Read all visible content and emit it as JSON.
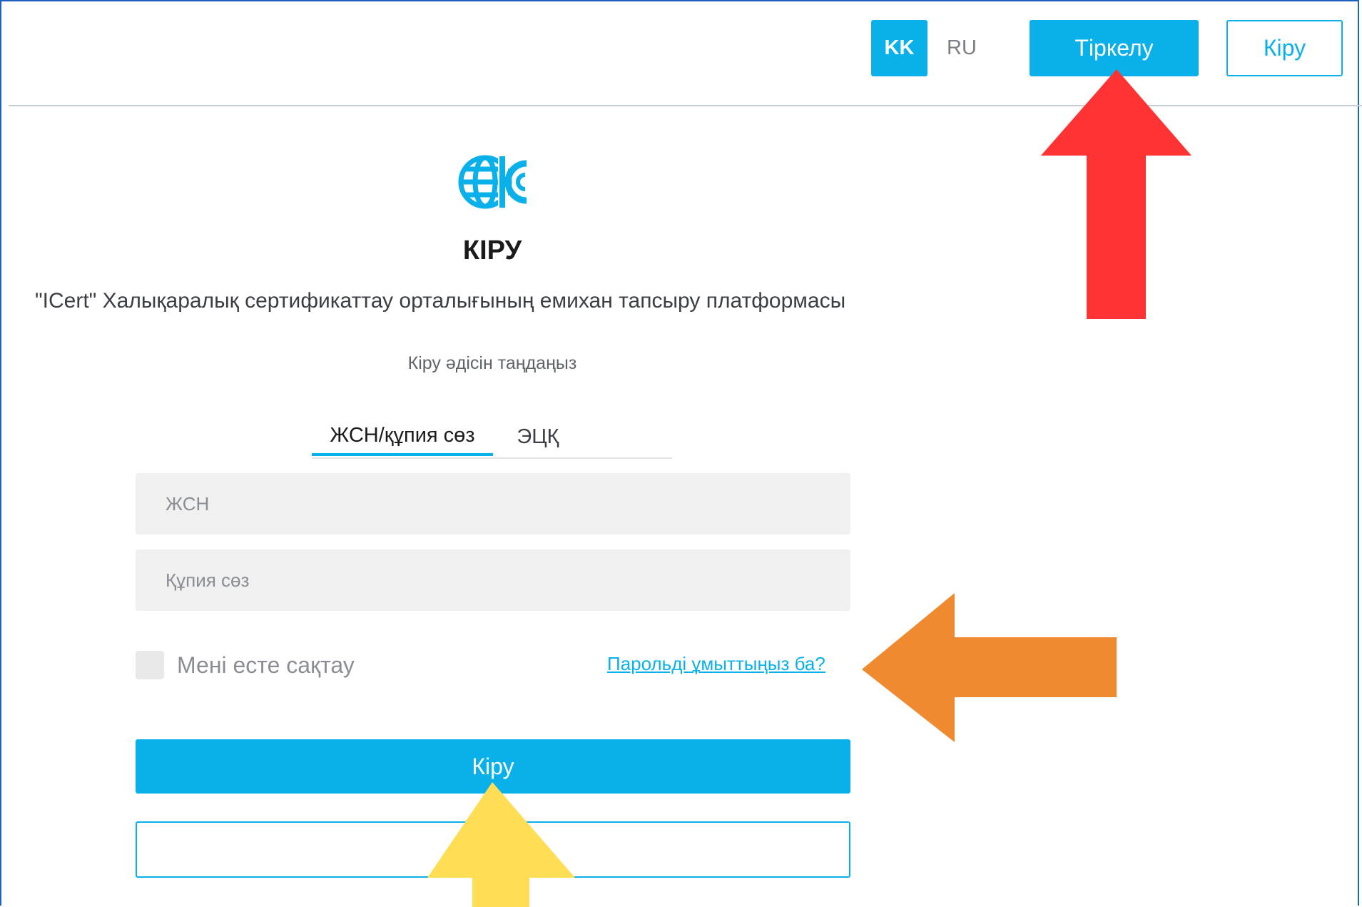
{
  "header": {
    "lang_kk": "KK",
    "lang_ru": "RU",
    "register_label": "Тіркелу",
    "login_label": "Кіру"
  },
  "main": {
    "title": "КІРУ",
    "subtitle": "\"ICert\" Халықаралық сертификаттау орталығының емихан тапсыру платформасы",
    "method_label": "Кіру әдісін таңдаңыз",
    "tabs": [
      {
        "label": "ЖСН/құпия сөз",
        "active": true
      },
      {
        "label": "ЭЦҚ",
        "active": false
      }
    ],
    "id_placeholder": "ЖСН",
    "password_placeholder": "Құпия сөз",
    "remember_label": "Мені есте сақтау",
    "forgot_label": "Парольді ұмыттыңыз ба?",
    "login_button": "Кіру"
  },
  "colors": {
    "accent": "#0ab0ea",
    "arrow_red": "#ff3333",
    "arrow_orange": "#ef8a30",
    "arrow_yellow": "#ffdd55"
  }
}
